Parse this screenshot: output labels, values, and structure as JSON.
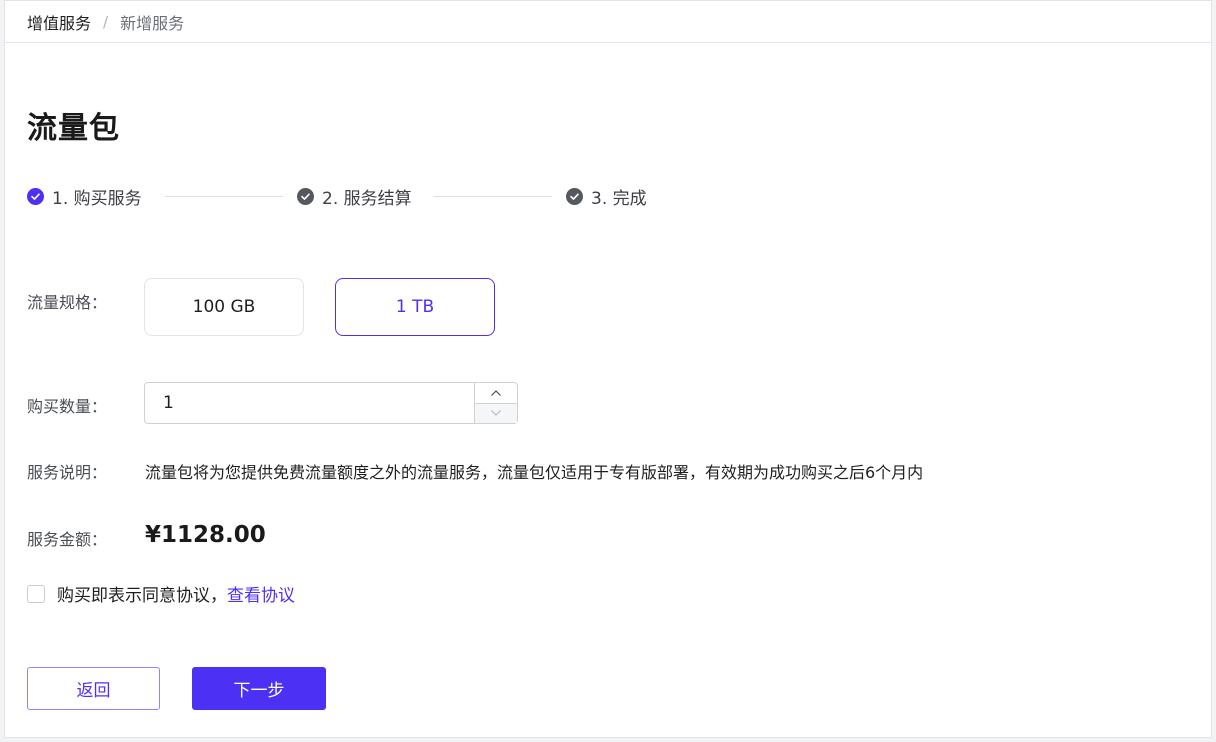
{
  "breadcrumb": {
    "root": "增值服务",
    "separator": "/",
    "current": "新增服务"
  },
  "page": {
    "title": "流量包"
  },
  "steps": [
    {
      "label": "1. 购买服务",
      "state": "active",
      "icon": "check-circle-icon"
    },
    {
      "label": "2. 服务结算",
      "state": "pending",
      "icon": "check-circle-icon"
    },
    {
      "label": "3. 完成",
      "state": "pending",
      "icon": "check-circle-icon"
    }
  ],
  "form": {
    "spec_label": "流量规格：",
    "spec_options": [
      "100 GB",
      "1 TB"
    ],
    "spec_selected": "1 TB",
    "qty_label": "购买数量：",
    "qty_value": "1",
    "desc_label": "服务说明：",
    "desc_text": "流量包将为您提供免费流量额度之外的流量服务，流量包仅适用于专有版部署，有效期为成功购买之后6个月内",
    "amount_label": "服务金额：",
    "amount_value": "¥1128.00"
  },
  "agreement": {
    "text": "购买即表示同意协议，",
    "link": "查看协议",
    "checked": false
  },
  "actions": {
    "back_label": "返回",
    "next_label": "下一步"
  },
  "colors": {
    "accent": "#4c31f5",
    "step_inactive": "#55585e",
    "border": "#e3e4e8"
  }
}
